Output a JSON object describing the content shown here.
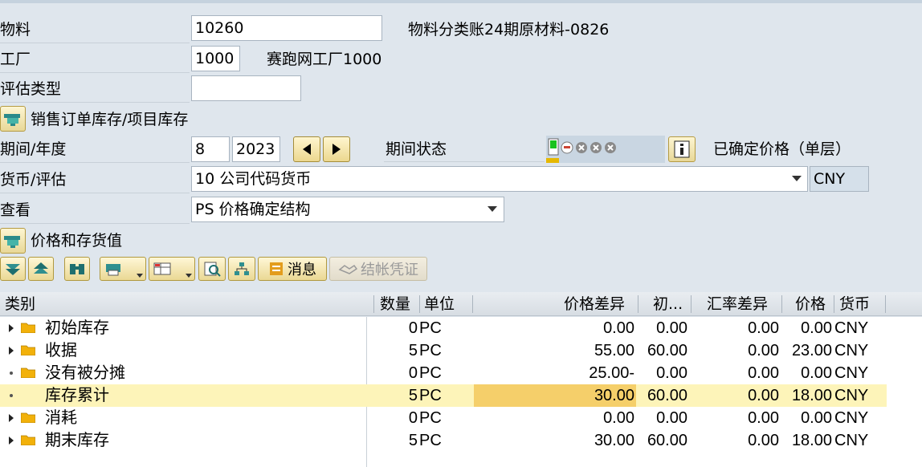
{
  "header": {
    "material_label": "物料",
    "material_value": "10260",
    "material_desc": "物料分类账24期原材料-0826",
    "plant_label": "工厂",
    "plant_value": "1000",
    "plant_desc": "赛跑网工厂1000",
    "valuation_type_label": "评估类型",
    "valuation_type_value": "",
    "sales_order_stock_label": "销售订单库存/项目库存",
    "period_year_label": "期间/年度",
    "period_value": "8",
    "year_value": "2023",
    "period_status_label": "期间状态",
    "price_status_text": "已确定价格（单层）",
    "currency_valuation_label": "货币/评估",
    "currency_valuation_value": "10 公司代码货币",
    "currency_code": "CNY",
    "view_label": "查看",
    "view_value": "PS 价格确定结构",
    "prices_stock_values_label": "价格和存货值"
  },
  "toolbar": {
    "messages_label": "消息",
    "posting_docs_label": "结帐凭证"
  },
  "colors": {
    "accent": "#f5cf6a",
    "highlight_row": "#fdf4b9",
    "folder": "#f2b10a"
  },
  "grid": {
    "columns": [
      "类别",
      "数量",
      "单位",
      "价格差异",
      "初...",
      "汇率差异",
      "价格",
      "货币"
    ],
    "rows": [
      {
        "category": "初始库存",
        "qty": "0",
        "unit": "PC",
        "price_diff": "0.00",
        "initial": "0.00",
        "fx_diff": "0.00",
        "price": "0.00",
        "currency": "CNY"
      },
      {
        "category": "收据",
        "qty": "5",
        "unit": "PC",
        "price_diff": "55.00",
        "initial": "60.00",
        "fx_diff": "0.00",
        "price": "23.00",
        "currency": "CNY"
      },
      {
        "category": "没有被分摊",
        "qty": "0",
        "unit": "PC",
        "price_diff": "25.00-",
        "initial": "0.00",
        "fx_diff": "0.00",
        "price": "0.00",
        "currency": "CNY"
      },
      {
        "category": "库存累计",
        "qty": "5",
        "unit": "PC",
        "price_diff": "30.00",
        "initial": "60.00",
        "fx_diff": "0.00",
        "price": "18.00",
        "currency": "CNY"
      },
      {
        "category": "消耗",
        "qty": "0",
        "unit": "PC",
        "price_diff": "0.00",
        "initial": "0.00",
        "fx_diff": "0.00",
        "price": "0.00",
        "currency": "CNY"
      },
      {
        "category": "期末库存",
        "qty": "5",
        "unit": "PC",
        "price_diff": "30.00",
        "initial": "60.00",
        "fx_diff": "0.00",
        "price": "18.00",
        "currency": "CNY"
      }
    ]
  }
}
